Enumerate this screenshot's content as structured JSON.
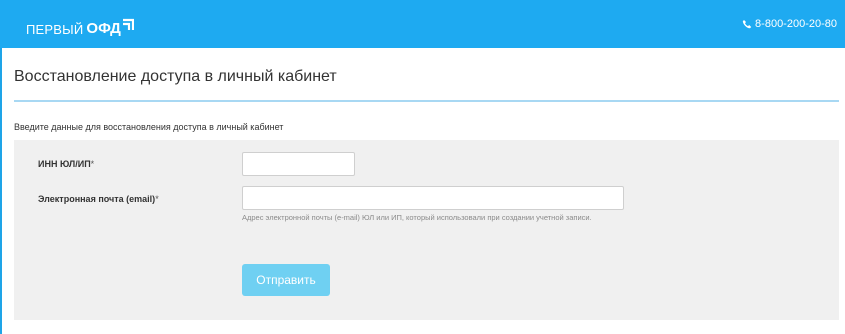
{
  "header": {
    "logo_prefix": "ПЕРВЫЙ",
    "logo_main": "ОФД",
    "phone": "8-800-200-20-80",
    "background_color": "#1eaaf1"
  },
  "page": {
    "title": "Восстановление доступа в личный кабинет",
    "intro": "Введите данные для восстановления доступа в личный кабинет"
  },
  "form": {
    "inn_label": "ИНН ЮЛ/ИП",
    "inn_value": "",
    "email_label": "Электронная почта (email)",
    "email_value": "",
    "required_mark": "*",
    "email_hint": "Адрес электронной почты (e-mail) ЮЛ или ИП, который использовали при создании учетной записи.",
    "submit_label": "Отправить",
    "button_color": "#6fd0f2"
  }
}
